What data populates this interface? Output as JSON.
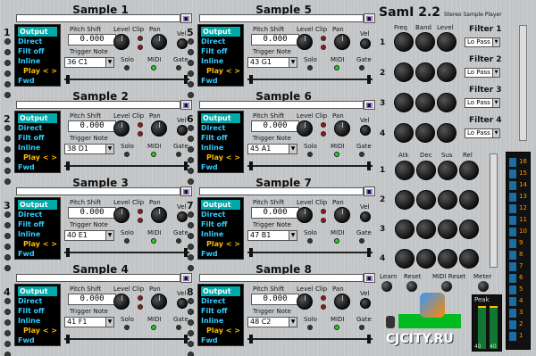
{
  "app": {
    "title": "SamI 2.2",
    "subtitle": "Stereo Sample Player"
  },
  "slot_labels": {
    "pitch_shift": "Pitch Shift",
    "trigger_note": "Trigger Note",
    "level": "Level",
    "clip": "Clip",
    "pan": "Pan",
    "vel": "Vel",
    "solo": "Solo",
    "midi": "MIDI",
    "gate": "Gate"
  },
  "panel_items": {
    "output": "Output",
    "direct": "Direct",
    "filt_off": "Filt off",
    "inline": "Inline",
    "play": "Play < >",
    "fwd": "Fwd"
  },
  "samples": [
    {
      "name": "Sample 1",
      "number": "1",
      "pitch": "0.000",
      "note": "36  C1"
    },
    {
      "name": "Sample 2",
      "number": "2",
      "pitch": "0.000",
      "note": "38  D1"
    },
    {
      "name": "Sample 3",
      "number": "3",
      "pitch": "0.000",
      "note": "40  E1"
    },
    {
      "name": "Sample 4",
      "number": "4",
      "pitch": "0.000",
      "note": "41  F1"
    },
    {
      "name": "Sample 5",
      "number": "5",
      "pitch": "0.000",
      "note": "43  G1"
    },
    {
      "name": "Sample 6",
      "number": "6",
      "pitch": "0.000",
      "note": "45  A1"
    },
    {
      "name": "Sample 7",
      "number": "7",
      "pitch": "0.000",
      "note": "47  B1"
    },
    {
      "name": "Sample 8",
      "number": "8",
      "pitch": "0.000",
      "note": "48  C2"
    }
  ],
  "filters": {
    "headers": {
      "freq": "Freq",
      "band": "Band",
      "level": "Level"
    },
    "rows": [
      {
        "num": "1",
        "label": "Filter 1",
        "type": "Lo Pass"
      },
      {
        "num": "2",
        "label": "Filter 2",
        "type": "Lo Pass"
      },
      {
        "num": "3",
        "label": "Filter 3",
        "type": "Lo Pass"
      },
      {
        "num": "4",
        "label": "Filter 4",
        "type": "Lo Pass"
      }
    ]
  },
  "envelope": {
    "headers": {
      "atk": "Atk",
      "dec": "Dec",
      "sus": "Sus",
      "rel": "Rel"
    },
    "rows": [
      "1",
      "2",
      "3",
      "4"
    ]
  },
  "bottom": {
    "learn": "Learn",
    "reset": "Reset",
    "midi_reset": "MIDI Reset",
    "meter": "Meter",
    "peak": "Peak",
    "peak_val1": "40",
    "peak_val2": "40"
  },
  "watermark": "CJCITY.RU",
  "meter_numbers": [
    "16",
    "15",
    "14",
    "13",
    "12",
    "11",
    "10",
    "9",
    "8",
    "7",
    "6",
    "5",
    "4",
    "3",
    "2",
    "1"
  ]
}
